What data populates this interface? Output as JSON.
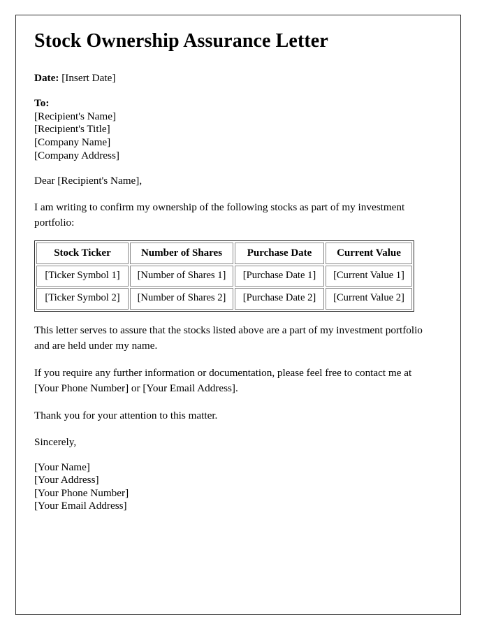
{
  "document": {
    "title": "Stock Ownership Assurance Letter",
    "date": {
      "label": "Date:",
      "value": "[Insert Date]"
    },
    "recipient": {
      "label": "To:",
      "lines": [
        "[Recipient's Name]",
        "[Recipient's Title]",
        "[Company Name]",
        "[Company Address]"
      ]
    },
    "salutation": "Dear [Recipient's Name],",
    "intro_paragraph": "I am writing to confirm my ownership of the following stocks as part of my investment portfolio:",
    "table": {
      "headers": [
        "Stock Ticker",
        "Number of Shares",
        "Purchase Date",
        "Current Value"
      ],
      "rows": [
        [
          "[Ticker Symbol 1]",
          "[Number of Shares 1]",
          "[Purchase Date 1]",
          "[Current Value 1]"
        ],
        [
          "[Ticker Symbol 2]",
          "[Number of Shares 2]",
          "[Purchase Date 2]",
          "[Current Value 2]"
        ]
      ]
    },
    "assurance_paragraph": "This letter serves to assure that the stocks listed above are a part of my investment portfolio and are held under my name.",
    "contact_paragraph": "If you require any further information or documentation, please feel free to contact me at [Your Phone Number] or [Your Email Address].",
    "thanks_paragraph": "Thank you for your attention to this matter.",
    "sign_off": "Sincerely,",
    "signature_lines": [
      "[Your Name]",
      "[Your Address]",
      "[Your Phone Number]",
      "[Your Email Address]"
    ]
  },
  "colors": {
    "page_border": "#2b2b2b",
    "table_border": "#8a8a8a",
    "text": "#000000",
    "background": "#ffffff"
  }
}
